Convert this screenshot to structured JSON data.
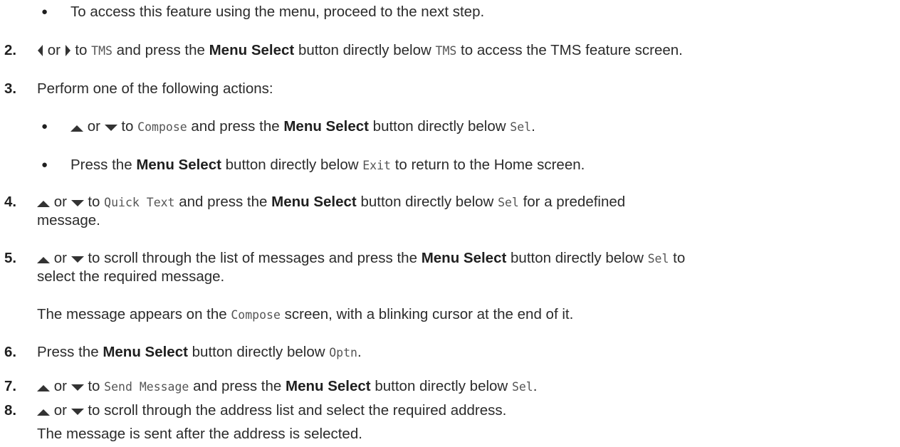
{
  "doc": {
    "intro_bullet": "To access this feature using the menu, proceed to the next step.",
    "s2": {
      "num": "2.",
      "or": "or",
      "t1": "to",
      "code1": "TMS",
      "t2": "and press the",
      "bold": "Menu Select",
      "t3": "button directly below",
      "code2": "TMS",
      "t4": "to access the TMS feature screen."
    },
    "s3": {
      "num": "3.",
      "text": "Perform one of the following actions:"
    },
    "s3a": {
      "or": "or",
      "t1": "to",
      "code1": "Compose",
      "t2": "and press the",
      "bold": "Menu Select",
      "t3": "button directly below",
      "code2": "Sel",
      "t4": "."
    },
    "s3b": {
      "t1": "Press the",
      "bold": "Menu Select",
      "t2": "button directly below",
      "code1": "Exit",
      "t3": "to return to the Home screen."
    },
    "s4": {
      "num": "4.",
      "or": "or",
      "t1": "to",
      "code1": "Quick Text",
      "t2": "and press the",
      "bold": "Menu Select",
      "t3": "button directly below",
      "code2": "Sel",
      "t4": "for a predefined",
      "cont": "message."
    },
    "s5": {
      "num": "5.",
      "or": "or",
      "t1": "to scroll through the list of messages and press the",
      "bold": "Menu Select",
      "t2": "button directly below",
      "code1": "Sel",
      "t3": "to",
      "cont": "select the required message."
    },
    "s5note": {
      "t1": "The message appears on the",
      "code1": "Compose",
      "t2": "screen, with a blinking cursor at the end of it."
    },
    "s6": {
      "num": "6.",
      "t1": "Press the",
      "bold": "Menu Select",
      "t2": "button directly below",
      "code1": "Optn",
      "t3": "."
    },
    "s7": {
      "num": "7.",
      "or": "or",
      "t1": "to",
      "code1": "Send Message",
      "t2": "and press the",
      "bold": "Menu Select",
      "t3": "button directly below",
      "code2": "Sel",
      "t4": "."
    },
    "s8": {
      "num": "8.",
      "or": "or",
      "t1": "to scroll through the address list and select the required address."
    },
    "s8note": "The message is sent after the address is selected."
  },
  "icons": {
    "left": "left-arrow-icon",
    "right": "right-arrow-icon",
    "up": "up-arrow-icon",
    "down": "down-arrow-icon",
    "bullet": "bullet-icon"
  }
}
